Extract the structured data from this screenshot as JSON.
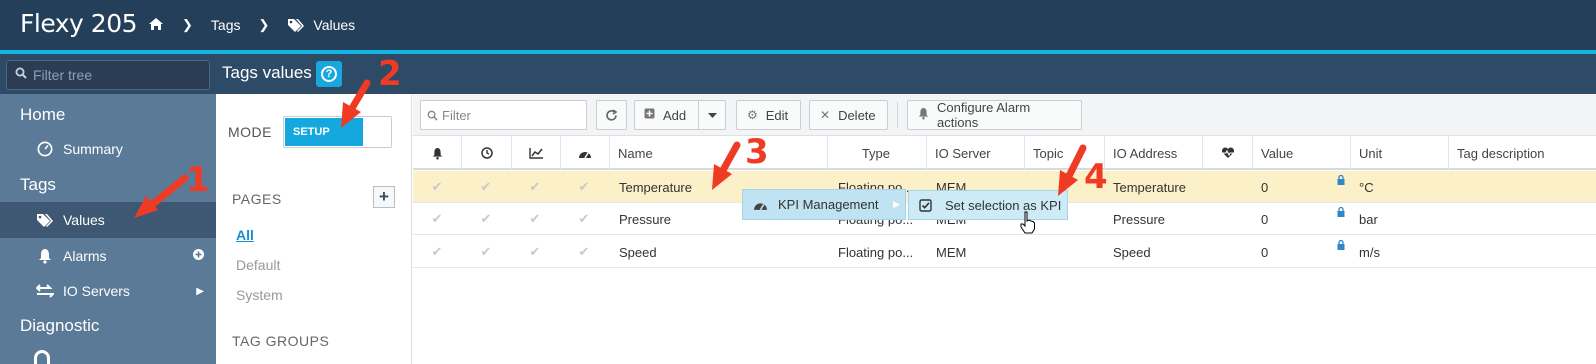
{
  "app": {
    "brand": "Flexy 205"
  },
  "breadcrumb": {
    "level1": "Tags",
    "level2": "Values"
  },
  "header": {
    "filter_tree_placeholder": "Filter tree",
    "page_title": "Tags values",
    "help_label": "?"
  },
  "sidebar": {
    "home": "Home",
    "summary": "Summary",
    "tags": "Tags",
    "values": "Values",
    "alarms": "Alarms",
    "io_servers": "IO Servers",
    "diagnostic": "Diagnostic"
  },
  "pages_panel": {
    "mode_label": "MODE",
    "mode_value": "SETUP",
    "pages_label": "PAGES",
    "pages": [
      "All",
      "Default",
      "System"
    ],
    "tag_groups_label": "TAG GROUPS"
  },
  "toolbar": {
    "filter_placeholder": "Filter",
    "add": "Add",
    "edit": "Edit",
    "delete": "Delete",
    "configure_alarm_actions": "Configure Alarm actions"
  },
  "table": {
    "columns": [
      "Name",
      "Type",
      "IO Server",
      "Topic",
      "IO Address",
      "Value",
      "Unit",
      "Tag description"
    ],
    "rows": [
      {
        "name": "Temperature",
        "type": "Floating po...",
        "io_server": "MEM",
        "topic": "",
        "io_address": "Temperature",
        "value": "0",
        "unit": "°C"
      },
      {
        "name": "Pressure",
        "type": "Floating po...",
        "io_server": "MEM",
        "topic": "",
        "io_address": "Pressure",
        "value": "0",
        "unit": "bar"
      },
      {
        "name": "Speed",
        "type": "Floating po...",
        "io_server": "MEM",
        "topic": "",
        "io_address": "Speed",
        "value": "0",
        "unit": "m/s"
      }
    ]
  },
  "context_menu": {
    "kpi_management": "KPI Management",
    "set_selection_as_kpi": "Set selection as KPI"
  },
  "annotations": {
    "n1": "1",
    "n2": "2",
    "n3": "3",
    "n4": "4"
  },
  "colors": {
    "topbar": "#243f5a",
    "accent": "#15b3e2",
    "sidebar": "#5b7a97",
    "selected_row": "#fcf0c8",
    "annotation": "#ef3b24"
  }
}
